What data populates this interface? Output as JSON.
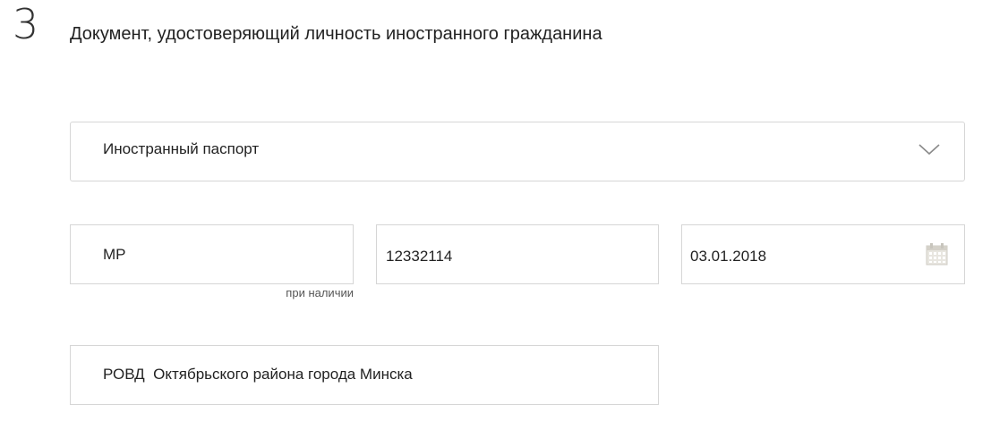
{
  "step": {
    "number": "3",
    "title": "Документ, удостоверяющий личность иностранного гражданина"
  },
  "document_type": {
    "selected": "Иностранный паспорт",
    "icon": "chevron-down-icon"
  },
  "series": {
    "value": "MP",
    "hint": "при наличии"
  },
  "number": {
    "value": "12332114"
  },
  "issue_date": {
    "value": "03.01.2018",
    "icon": "calendar-icon"
  },
  "issued_by": {
    "value": "РОВД  Октябрьского района города Минска"
  }
}
